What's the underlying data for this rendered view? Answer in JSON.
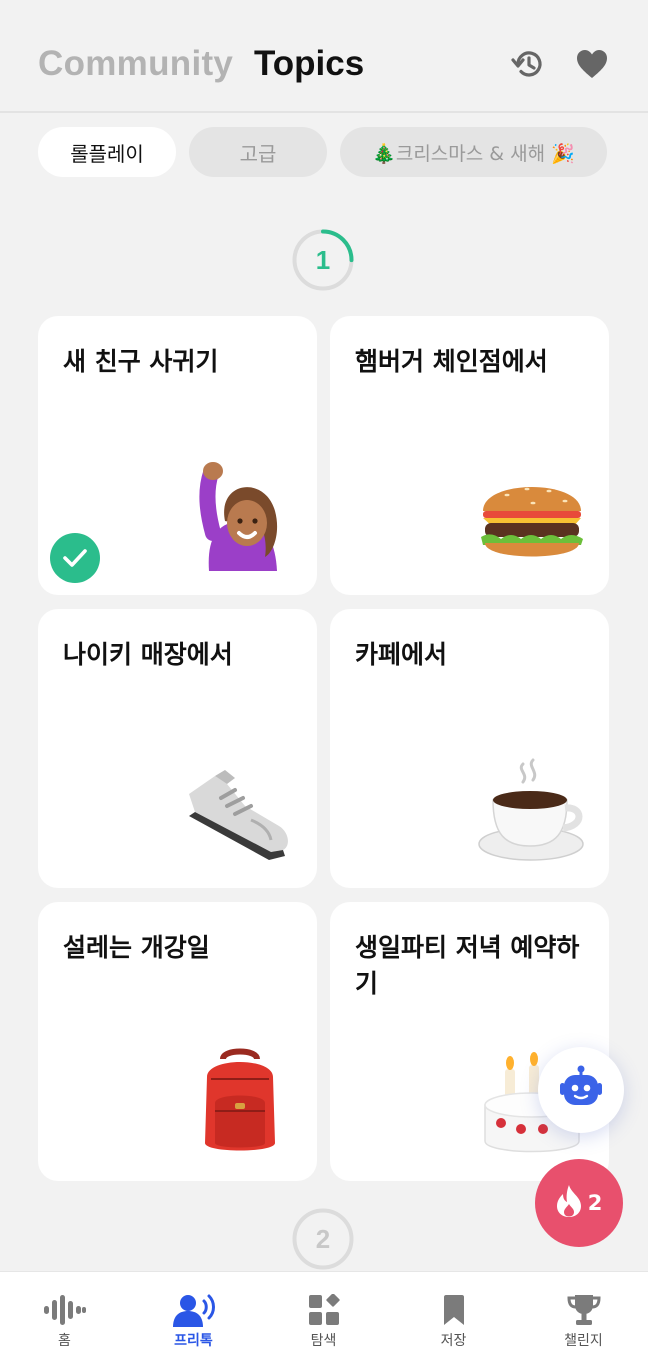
{
  "header": {
    "tab_community": "Community",
    "tab_topics": "Topics",
    "icons": [
      "history-icon",
      "heart-icon"
    ]
  },
  "chips": [
    {
      "label": "롤플레이",
      "selected": true
    },
    {
      "label": "고급",
      "selected": false
    },
    {
      "label": "🎄크리스마스 & 새해 🎉",
      "selected": false
    }
  ],
  "progress": [
    {
      "number": "1",
      "fraction": 0.25,
      "color": "#2bbd8c"
    },
    {
      "number": "2",
      "fraction": 0,
      "color": "#c8c8c8"
    }
  ],
  "cards": [
    {
      "title": "새 친구 사귀기",
      "icon": "waving-person-icon",
      "completed": true
    },
    {
      "title": "햄버거 체인점에서",
      "icon": "hamburger-icon",
      "completed": false
    },
    {
      "title": "나이키 매장에서",
      "icon": "sneaker-icon",
      "completed": false
    },
    {
      "title": "카페에서",
      "icon": "coffee-cup-icon",
      "completed": false
    },
    {
      "title": "설레는 개강일",
      "icon": "backpack-icon",
      "completed": false
    },
    {
      "title": "생일파티 저녁 예약하기",
      "icon": "birthday-cake-icon",
      "completed": false
    }
  ],
  "fab": {
    "bot_icon": "robot-icon",
    "streak_count": "2",
    "streak_icon": "fire-icon"
  },
  "nav": [
    {
      "label": "홈",
      "icon": "audio-wave-icon",
      "active": false
    },
    {
      "label": "프리톡",
      "icon": "speaking-person-icon",
      "active": true
    },
    {
      "label": "탐색",
      "icon": "grid-icon",
      "active": false
    },
    {
      "label": "저장",
      "icon": "bookmark-icon",
      "active": false
    },
    {
      "label": "챌린지",
      "icon": "trophy-icon",
      "active": false
    }
  ],
  "colors": {
    "accent_green": "#2bbd8c",
    "accent_blue": "#2a56e6",
    "fire_pink": "#e8506d",
    "background": "#f2f2f2"
  }
}
